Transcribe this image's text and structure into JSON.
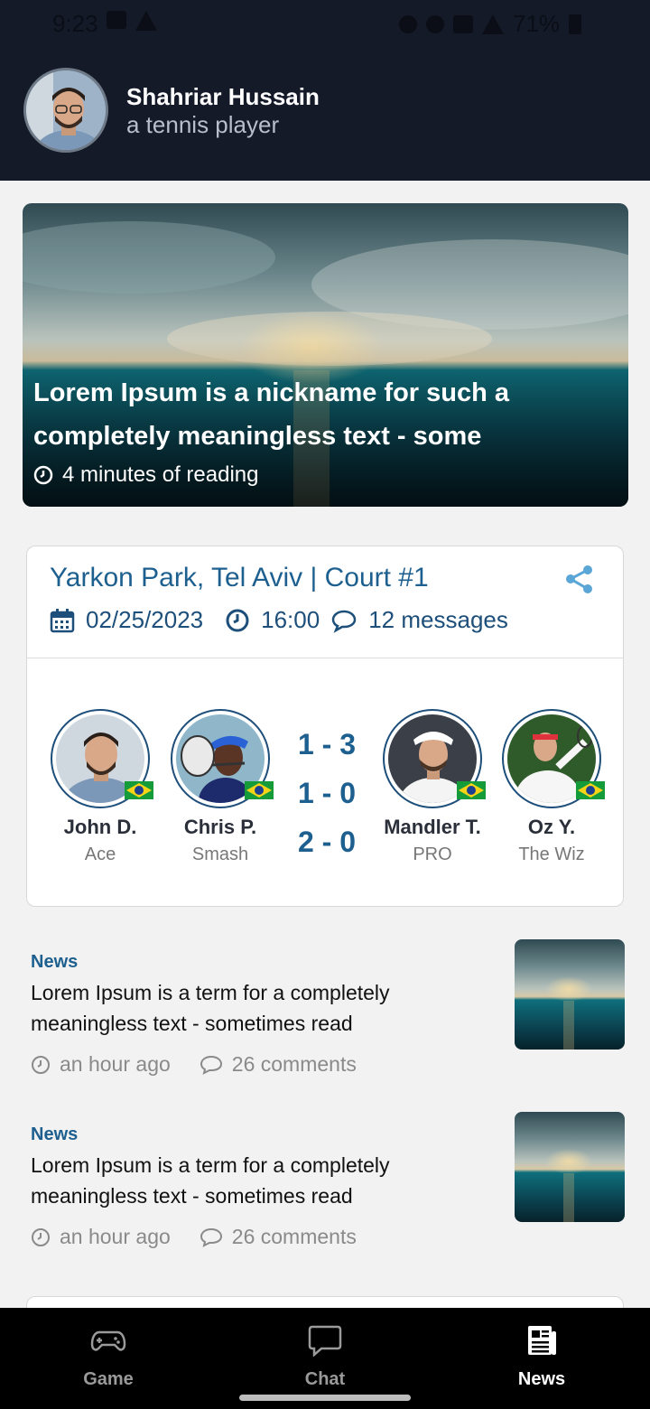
{
  "status_bar": {
    "time": "9:23",
    "battery": "71%"
  },
  "profile": {
    "name": "Shahriar Hussain",
    "subtitle": "a tennis player"
  },
  "hero": {
    "title": "Lorem Ipsum is a nickname for such a completely meaningless text - some",
    "reading_time": "4 minutes of reading"
  },
  "match": {
    "location": "Yarkon Park, Tel Aviv | Court #1",
    "date": "02/25/2023",
    "time": "16:00",
    "messages": "12 messages",
    "players": [
      {
        "name": "John D.",
        "nickname": "Ace"
      },
      {
        "name": "Chris P.",
        "nickname": "Smash"
      },
      {
        "name": "Mandler T.",
        "nickname": "PRO"
      },
      {
        "name": "Oz Y.",
        "nickname": "The Wiz"
      }
    ],
    "scores": [
      "1 - 3",
      "1 - 0",
      "2 - 0"
    ]
  },
  "news": [
    {
      "tag": "News",
      "title": "Lorem Ipsum is a term for a completely meaningless text - sometimes read",
      "time": "an hour ago",
      "comments": "26 comments"
    },
    {
      "tag": "News",
      "title": "Lorem Ipsum is a term for a completely meaningless text - sometimes read",
      "time": "an hour ago",
      "comments": "26 comments"
    }
  ],
  "nav": {
    "tabs": [
      {
        "label": "Game",
        "icon": "gamepad-icon",
        "active": false
      },
      {
        "label": "Chat",
        "icon": "chat-icon",
        "active": false
      },
      {
        "label": "News",
        "icon": "newspaper-icon",
        "active": true
      }
    ]
  },
  "colors": {
    "header_bg": "#141a28",
    "accent": "#1d5f8f",
    "nav_bg": "#000000",
    "page_bg": "#f2f2f2"
  }
}
